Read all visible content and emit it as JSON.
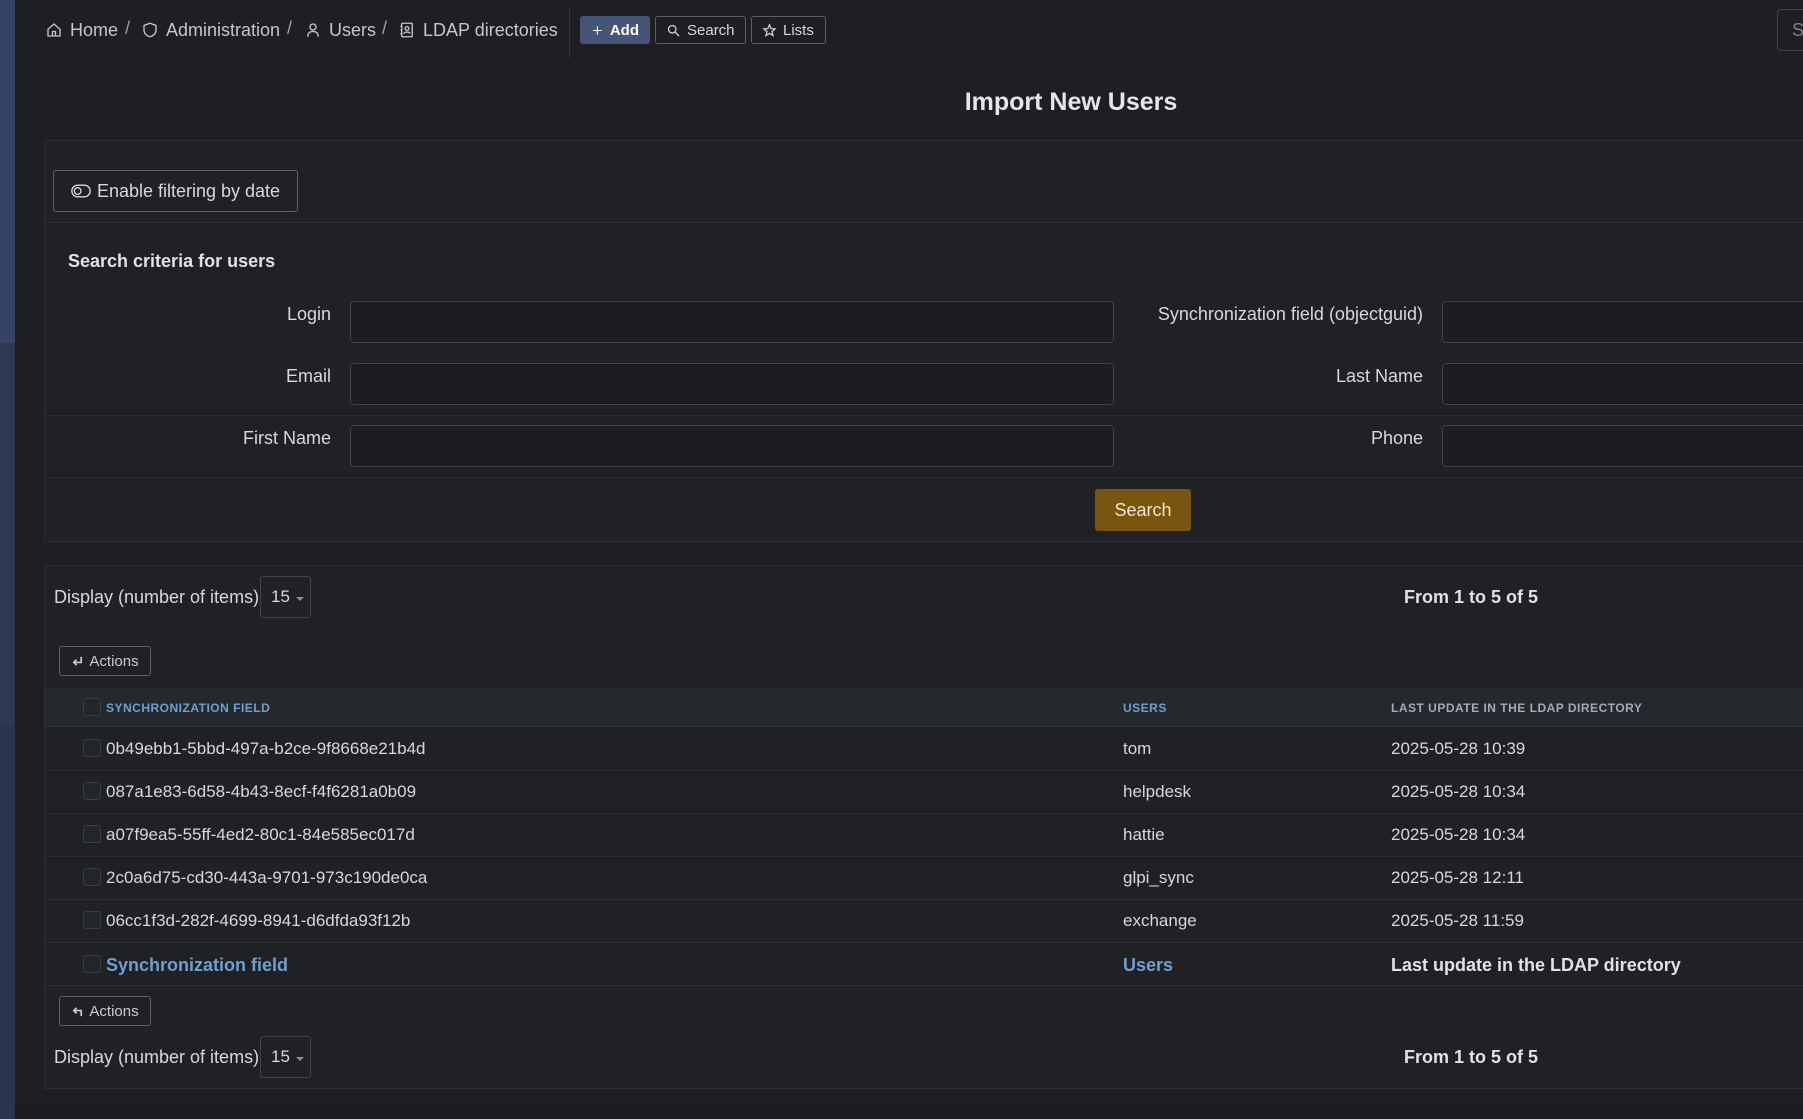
{
  "breadcrumb": {
    "home": "Home",
    "administration": "Administration",
    "users": "Users",
    "ldap": "LDAP directories",
    "separator": "/"
  },
  "toolbar": {
    "add": "Add",
    "search": "Search",
    "lists": "Lists"
  },
  "global_search": {
    "placeholder": "Sea"
  },
  "page_title": "Import New Users",
  "filter_button": "Enable filtering by date",
  "criteria": {
    "title": "Search criteria for users",
    "login": "Login",
    "sync_field": "Synchronization field (objectguid)",
    "email": "Email",
    "last_name": "Last Name",
    "first_name": "First Name",
    "phone": "Phone",
    "search_button": "Search"
  },
  "display": {
    "label": "Display (number of items)",
    "value": "15",
    "pager": "From 1 to 5 of 5"
  },
  "actions_label": "Actions",
  "table": {
    "headers": [
      "SYNCHRONIZATION FIELD",
      "USERS",
      "LAST UPDATE IN THE LDAP DIRECTORY"
    ],
    "rows": [
      {
        "sync": "0b49ebb1-5bbd-497a-b2ce-9f8668e21b4d",
        "user": "tom",
        "updated": "2025-05-28 10:39"
      },
      {
        "sync": "087a1e83-6d58-4b43-8ecf-f4f6281a0b09",
        "user": "helpdesk",
        "updated": "2025-05-28 10:34"
      },
      {
        "sync": "a07f9ea5-55ff-4ed2-80c1-84e585ec017d",
        "user": "hattie",
        "updated": "2025-05-28 10:34"
      },
      {
        "sync": "2c0a6d75-cd30-443a-9701-973c190de0ca",
        "user": "glpi_sync",
        "updated": "2025-05-28 12:11"
      },
      {
        "sync": "06cc1f3d-282f-4699-8941-d6dfda93f12b",
        "user": "exchange",
        "updated": "2025-05-28 11:59"
      }
    ],
    "footer": [
      "Synchronization field",
      "Users",
      "Last update in the LDAP directory"
    ]
  },
  "colors": {
    "accent": "#7a5510",
    "link": "#6f9fd2",
    "add_button": "#465577"
  }
}
